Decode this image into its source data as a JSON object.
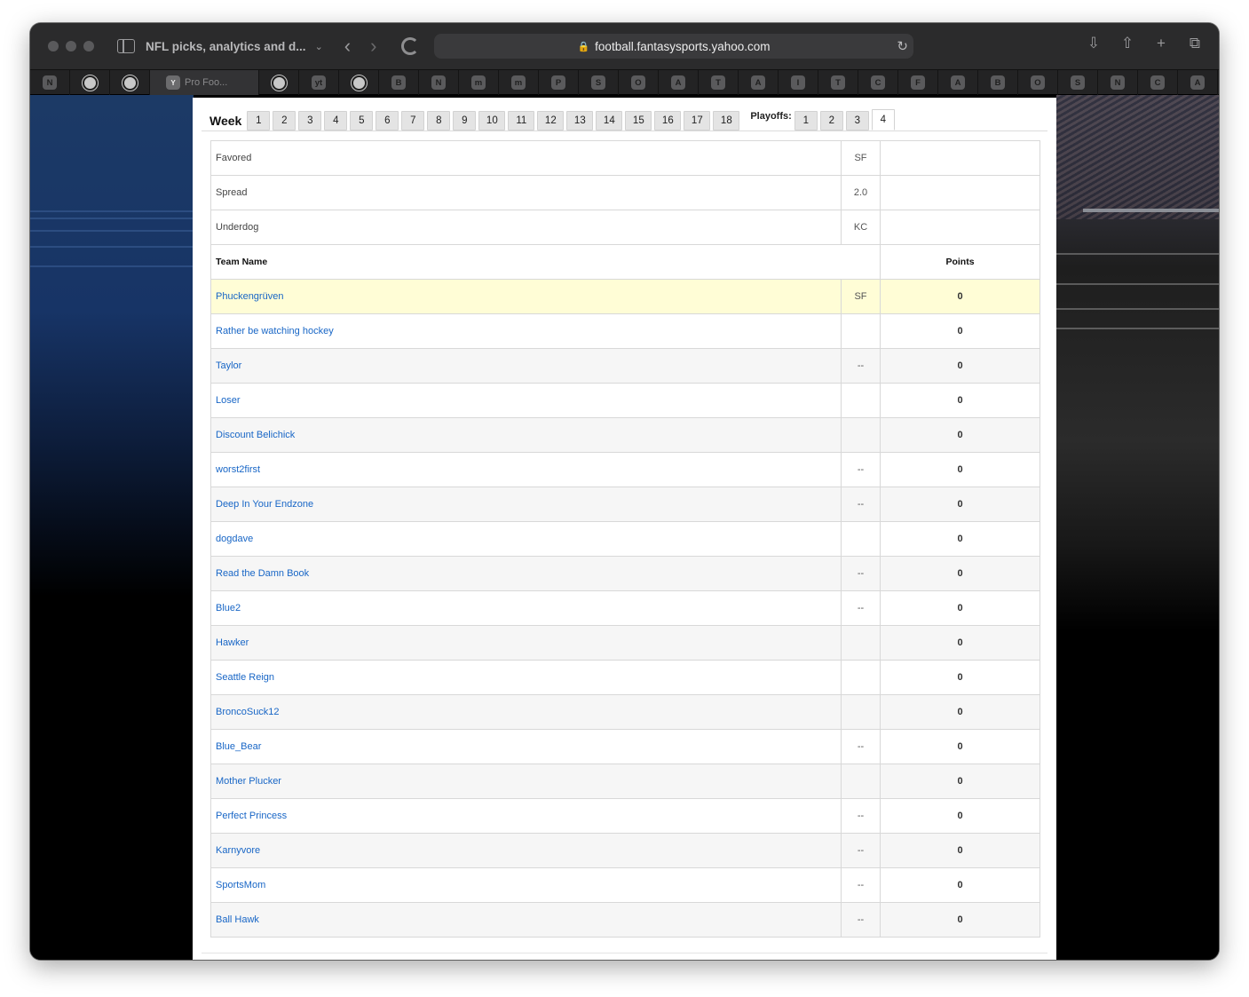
{
  "browser": {
    "tab_title": "NFL picks, analytics and d...",
    "url": "football.fantasysports.yahoo.com",
    "active_tab_label": "Pro Foo...",
    "favorites": [
      "N",
      "github",
      "github",
      "Y",
      "github",
      "yt",
      "github",
      "B",
      "N",
      "m",
      "m",
      "P",
      "S",
      "O",
      "A",
      "T",
      "A",
      "I",
      "T",
      "C",
      "F",
      "A",
      "B",
      "O",
      "S",
      "N",
      "C",
      "A"
    ]
  },
  "weekbar": {
    "week_label": "Week",
    "weeks": [
      "1",
      "2",
      "3",
      "4",
      "5",
      "6",
      "7",
      "8",
      "9",
      "10",
      "11",
      "12",
      "13",
      "14",
      "15",
      "16",
      "17",
      "18"
    ],
    "playoffs_label": "Playoffs:",
    "playoffs": [
      "1",
      "2",
      "3",
      "4"
    ],
    "active_playoff": "4"
  },
  "matchup": {
    "favored_label": "Favored",
    "favored_value": "SF",
    "spread_label": "Spread",
    "spread_value": "2.0",
    "underdog_label": "Underdog",
    "underdog_value": "KC"
  },
  "table": {
    "col_team": "Team Name",
    "col_points": "Points",
    "rows": [
      {
        "team": "Phuckengrüven",
        "pick": "SF",
        "points": "0"
      },
      {
        "team": "Rather be watching hockey",
        "pick": "",
        "points": "0"
      },
      {
        "team": "Taylor",
        "pick": "--",
        "points": "0"
      },
      {
        "team": "Loser",
        "pick": "",
        "points": "0"
      },
      {
        "team": "Discount Belichick",
        "pick": "",
        "points": "0"
      },
      {
        "team": "worst2first",
        "pick": "--",
        "points": "0"
      },
      {
        "team": "Deep In Your Endzone",
        "pick": "--",
        "points": "0"
      },
      {
        "team": "dogdave",
        "pick": "",
        "points": "0"
      },
      {
        "team": "Read the Damn Book",
        "pick": "--",
        "points": "0"
      },
      {
        "team": "Blue2",
        "pick": "--",
        "points": "0"
      },
      {
        "team": "Hawker",
        "pick": "",
        "points": "0"
      },
      {
        "team": "Seattle Reign",
        "pick": "",
        "points": "0"
      },
      {
        "team": "BroncoSuck12",
        "pick": "",
        "points": "0"
      },
      {
        "team": "Blue_Bear",
        "pick": "--",
        "points": "0"
      },
      {
        "team": "Mother Plucker",
        "pick": "",
        "points": "0"
      },
      {
        "team": "Perfect Princess",
        "pick": "--",
        "points": "0"
      },
      {
        "team": "Karnyvore",
        "pick": "--",
        "points": "0"
      },
      {
        "team": "SportsMom",
        "pick": "--",
        "points": "0"
      },
      {
        "team": "Ball Hawk",
        "pick": "--",
        "points": "0"
      }
    ]
  },
  "colors": {
    "link": "#1866c6",
    "highlight_row": "#fffdd6",
    "alt_row": "#f6f6f6"
  }
}
